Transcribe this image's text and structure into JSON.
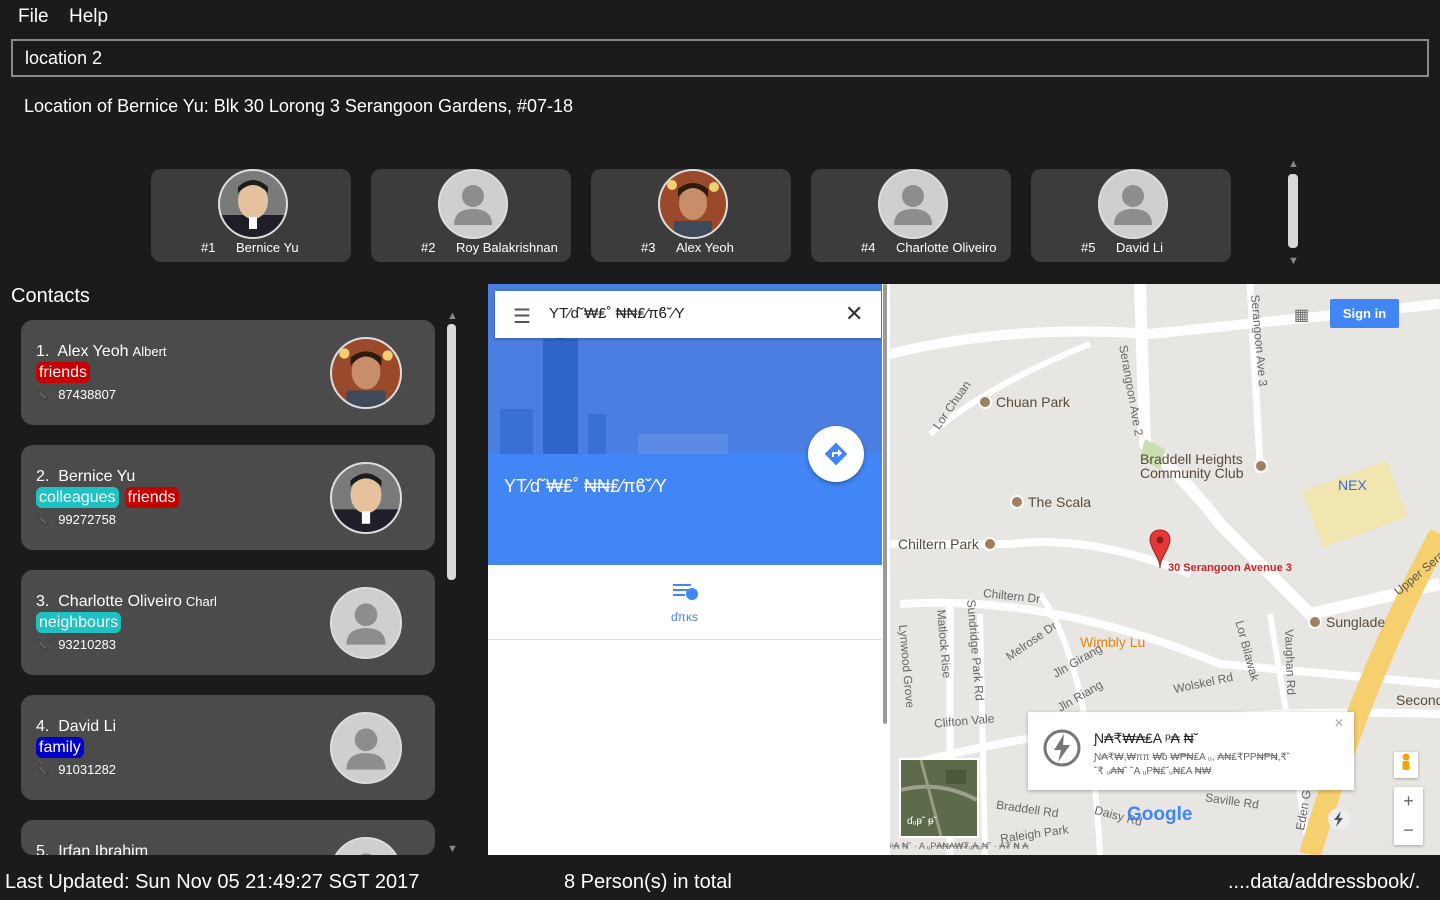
{
  "menu": {
    "file": "File",
    "help": "Help"
  },
  "command": {
    "value": "location 2"
  },
  "result": {
    "text": "Location of Bernice Yu: Blk 30 Lorong 3 Serangoon Gardens, #07-18"
  },
  "favorites": [
    {
      "num": "#1",
      "name": "Bernice Yu",
      "photo": "photo"
    },
    {
      "num": "#2",
      "name": "Roy Balakrishnan",
      "photo": "default"
    },
    {
      "num": "#3",
      "name": "Alex Yeoh",
      "photo": "photo"
    },
    {
      "num": "#4",
      "name": "Charlotte Oliveiro",
      "photo": "default"
    },
    {
      "num": "#5",
      "name": "David Li",
      "photo": "default"
    }
  ],
  "contacts": {
    "heading": "Contacts",
    "items": [
      {
        "index": "1.",
        "name": "Alex Yeoh",
        "alias": "Albert",
        "tags": [
          {
            "label": "friends",
            "color": "#c40000"
          }
        ],
        "phone": "87438807"
      },
      {
        "index": "2.",
        "name": "Bernice Yu",
        "alias": "",
        "tags": [
          {
            "label": "colleagues",
            "color": "#1fc2c2"
          },
          {
            "label": "friends",
            "color": "#c40000"
          }
        ],
        "phone": "99272758"
      },
      {
        "index": "3.",
        "name": "Charlotte Oliveiro",
        "alias": "Charl",
        "tags": [
          {
            "label": "neighbours",
            "color": "#1fc2c2"
          }
        ],
        "phone": "93210283"
      },
      {
        "index": "4.",
        "name": "David Li",
        "alias": "",
        "tags": [
          {
            "label": "family",
            "color": "#0000c8"
          }
        ],
        "phone": "91031282"
      },
      {
        "index": "5.",
        "name": "Irfan Ibrahim",
        "alias": "",
        "tags": [],
        "phone": ""
      }
    ]
  },
  "map": {
    "search_text": "YT⁄ɗ˘₩₤˚ ₦₦₤⁄πϐ˘⁄Y",
    "hero_title": "YT⁄ɗ˘₩₤˚ ₦₦₤⁄πϐ˘⁄Y",
    "action_label": "ɗπκs",
    "sign_in": "Sign in",
    "marker_label": "30 Serangoon Avenue 3",
    "places": [
      "Chuan Park",
      "Braddell Heights Community Club",
      "The Scala",
      "Chiltern Park",
      "NEX",
      "Wimbly Lu",
      "Sunglade",
      "Second"
    ],
    "roads": [
      "Serangoon Ave 2",
      "Serangoon Ave 3",
      "Lor Chuan",
      "Chiltern Dr",
      "Jln Girang",
      "Jln Riang",
      "Wolskel Rd",
      "Clifton Vale",
      "Braddell Rd",
      "Sundridge Park Rd",
      "Melrose Dr",
      "Matlock Rise",
      "Lynwood Grove",
      "Lor Bilawak",
      "Vaughan Rd",
      "Upper Seran",
      "Daisy Rd",
      "Raleigh Park",
      "Saville Rd",
      "Eden Grove"
    ],
    "info_title": "Ɲ₳₹₩₳₤A ᵖ₳ ₦˘",
    "info_line1": "Ɲ₳₹₩,₩ππ ₩ᵬ ₩₱₦₤A ᵤ, ₳₦₤₹PP₦₱₦,₹˘",
    "info_line2": "˘₹ ᵤ₳₦˘ ˘A ᵤP₦₤˘ᵤ₦₤A ₦₩",
    "thumb_label": "ɗᵤᵽ˘ ᵽ˘",
    "google": "Google",
    "footer": "ᵖ₳ ₦˘ · A ᵤP₳₦₳₩₮ᵤ₳ᵤ₦˘ · ₳₮ ₦ ₳"
  },
  "status": {
    "updated": "Last Updated: Sun Nov 05 21:49:27 SGT 2017",
    "total": "8 Person(s) in total",
    "path": "....data/addressbook/."
  }
}
